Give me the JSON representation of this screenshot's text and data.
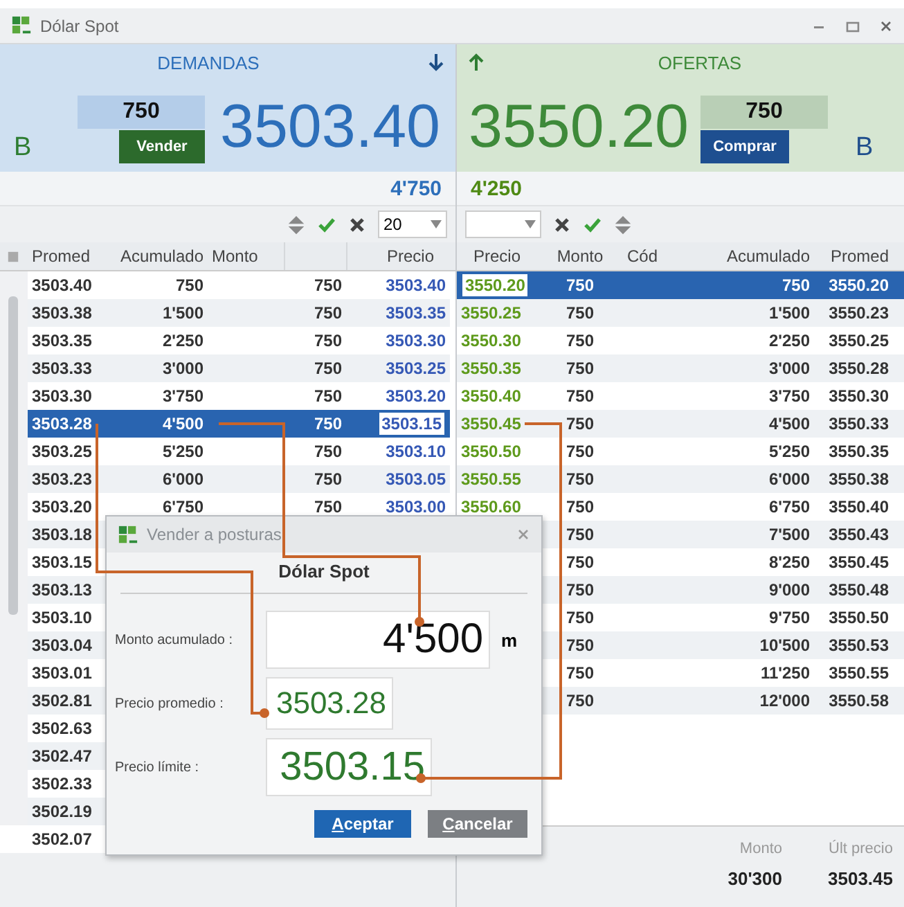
{
  "window": {
    "title": "Dólar Spot"
  },
  "demandas": {
    "title": "DEMANDAS",
    "side_letter": "B",
    "quantity": "750",
    "button": "Vender",
    "price": "3503.40",
    "total": "4'750",
    "filter_value": "20"
  },
  "ofertas": {
    "title": "OFERTAS",
    "side_letter": "B",
    "quantity": "750",
    "button": "Comprar",
    "price": "3550.20",
    "total": "4'250"
  },
  "bid_table": {
    "columns": [
      "Promed",
      "Acumulado",
      "Monto",
      "Precio"
    ],
    "rows": [
      {
        "promed": "3503.40",
        "acumulado": "750",
        "column_4": "750",
        "precio": "3503.40",
        "selected": false
      },
      {
        "promed": "3503.38",
        "acumulado": "1'500",
        "column_4": "750",
        "precio": "3503.35",
        "selected": false
      },
      {
        "promed": "3503.35",
        "acumulado": "2'250",
        "column_4": "750",
        "precio": "3503.30",
        "selected": false
      },
      {
        "promed": "3503.33",
        "acumulado": "3'000",
        "column_4": "750",
        "precio": "3503.25",
        "selected": false
      },
      {
        "promed": "3503.30",
        "acumulado": "3'750",
        "column_4": "750",
        "precio": "3503.20",
        "selected": false
      },
      {
        "promed": "3503.28",
        "acumulado": "4'500",
        "column_4": "750",
        "precio": "3503.15",
        "selected": true
      },
      {
        "promed": "3503.25",
        "acumulado": "5'250",
        "column_4": "750",
        "precio": "3503.10",
        "selected": false
      },
      {
        "promed": "3503.23",
        "acumulado": "6'000",
        "column_4": "750",
        "precio": "3503.05",
        "selected": false
      },
      {
        "promed": "3503.20",
        "acumulado": "6'750",
        "column_4": "750",
        "precio": "3503.00",
        "selected": false
      },
      {
        "promed": "3503.18",
        "selected": false
      },
      {
        "promed": "3503.15",
        "selected": false
      },
      {
        "promed": "3503.13",
        "selected": false
      },
      {
        "promed": "3503.10",
        "selected": false
      },
      {
        "promed": "3503.04",
        "selected": false
      },
      {
        "promed": "3503.01",
        "selected": false
      },
      {
        "promed": "3502.81",
        "selected": false
      },
      {
        "promed": "3502.63",
        "selected": false
      },
      {
        "promed": "3502.47",
        "selected": false
      },
      {
        "promed": "3502.33",
        "selected": false
      },
      {
        "promed": "3502.19",
        "selected": false
      },
      {
        "promed": "3502.07",
        "selected": false
      }
    ]
  },
  "offer_table": {
    "columns": [
      "Precio",
      "Monto",
      "Cód",
      "Acumulado",
      "Promed"
    ],
    "rows": [
      {
        "precio": "3550.20",
        "monto": "750",
        "acumulado": "750",
        "promed": "3550.20",
        "selected": true
      },
      {
        "precio": "3550.25",
        "monto": "750",
        "acumulado": "1'500",
        "promed": "3550.23",
        "selected": false
      },
      {
        "precio": "3550.30",
        "monto": "750",
        "acumulado": "2'250",
        "promed": "3550.25",
        "selected": false
      },
      {
        "precio": "3550.35",
        "monto": "750",
        "acumulado": "3'000",
        "promed": "3550.28",
        "selected": false
      },
      {
        "precio": "3550.40",
        "monto": "750",
        "acumulado": "3'750",
        "promed": "3550.30",
        "selected": false
      },
      {
        "precio": "3550.45",
        "monto": "750",
        "acumulado": "4'500",
        "promed": "3550.33",
        "selected": false
      },
      {
        "precio": "3550.50",
        "monto": "750",
        "acumulado": "5'250",
        "promed": "3550.35",
        "selected": false
      },
      {
        "precio": "3550.55",
        "monto": "750",
        "acumulado": "6'000",
        "promed": "3550.38",
        "selected": false
      },
      {
        "precio": "3550.60",
        "monto": "750",
        "acumulado": "6'750",
        "promed": "3550.40",
        "selected": false
      },
      {
        "monto": "750",
        "acumulado": "7'500",
        "promed": "3550.43",
        "selected": false
      },
      {
        "monto": "750",
        "acumulado": "8'250",
        "promed": "3550.45",
        "selected": false
      },
      {
        "monto": "750",
        "acumulado": "9'000",
        "promed": "3550.48",
        "selected": false
      },
      {
        "monto": "750",
        "acumulado": "9'750",
        "promed": "3550.50",
        "selected": false
      },
      {
        "monto": "750",
        "acumulado": "10'500",
        "promed": "3550.53",
        "selected": false
      },
      {
        "monto": "750",
        "acumulado": "11'250",
        "promed": "3550.55",
        "selected": false
      },
      {
        "monto": "750",
        "acumulado": "12'000",
        "promed": "3550.58",
        "selected": false
      }
    ]
  },
  "summary": [
    {
      "label": "Monto",
      "value": "30'300"
    },
    {
      "label": "Últ precio",
      "value": "3503.45"
    }
  ],
  "dialog": {
    "title": "Vender a posturas",
    "heading": "Dólar Spot",
    "fields": [
      {
        "label": "Monto acumulado :",
        "value": "4'500",
        "unit": "m",
        "kind": "amount"
      },
      {
        "label": "Precio promedio :",
        "value": "3503.28",
        "kind": "average"
      },
      {
        "label": "Precio límite :",
        "value": "3503.15",
        "kind": "limit"
      }
    ],
    "buttons": [
      {
        "label": "Aceptar",
        "kind": "primary"
      },
      {
        "label": "Cancelar",
        "kind": "secondary"
      }
    ]
  }
}
